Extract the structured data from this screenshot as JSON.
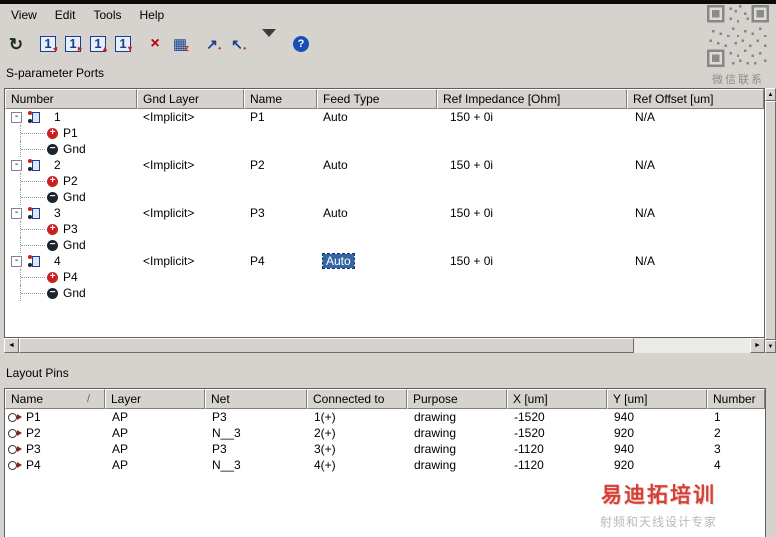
{
  "menubar": {
    "items": [
      "View",
      "Edit",
      "Tools",
      "Help"
    ]
  },
  "toolbar": {
    "buttons": [
      {
        "name": "refresh-ports",
        "main": "↻",
        "accent": ""
      },
      {
        "name": "port-properties",
        "main": "1",
        "accent": "◂"
      },
      {
        "name": "renumber-ports",
        "main": "1",
        "accent": "▸"
      },
      {
        "name": "move-port-up",
        "main": "1",
        "accent": "▴"
      },
      {
        "name": "move-port-down",
        "main": "1",
        "accent": "▾"
      },
      {
        "name": "delete-port",
        "main": "×",
        "accent": ""
      },
      {
        "name": "impedance-editor",
        "main": "▦",
        "accent": "z"
      },
      {
        "name": "align-pins",
        "main": "↗",
        "accent": "•"
      },
      {
        "name": "pick-pins",
        "main": "↖",
        "accent": "•"
      },
      {
        "name": "filter",
        "main": "",
        "accent": ""
      },
      {
        "name": "help",
        "main": "?",
        "accent": ""
      }
    ]
  },
  "sections": {
    "sparam_title": "S-parameter Ports",
    "layout_pins_title": "Layout Pins"
  },
  "sparam_table": {
    "columns": [
      "Number",
      "Gnd Layer",
      "Name",
      "Feed Type",
      "Ref Impedance [Ohm]",
      "Ref Offset [um]"
    ],
    "groups": [
      {
        "number": "1",
        "gnd_layer": "<Implicit>",
        "name": "P1",
        "feed_type": "Auto",
        "ref_impedance": "150 + 0i",
        "ref_offset": "N/A",
        "feed_selected": false,
        "pins": [
          {
            "label": "P1"
          },
          {
            "label": "Gnd"
          }
        ]
      },
      {
        "number": "2",
        "gnd_layer": "<Implicit>",
        "name": "P2",
        "feed_type": "Auto",
        "ref_impedance": "150 + 0i",
        "ref_offset": "N/A",
        "feed_selected": false,
        "pins": [
          {
            "label": "P2"
          },
          {
            "label": "Gnd"
          }
        ]
      },
      {
        "number": "3",
        "gnd_layer": "<Implicit>",
        "name": "P3",
        "feed_type": "Auto",
        "ref_impedance": "150 + 0i",
        "ref_offset": "N/A",
        "feed_selected": false,
        "pins": [
          {
            "label": "P3"
          },
          {
            "label": "Gnd"
          }
        ]
      },
      {
        "number": "4",
        "gnd_layer": "<Implicit>",
        "name": "P4",
        "feed_type": "Auto",
        "ref_impedance": "150 + 0i",
        "ref_offset": "N/A",
        "feed_selected": true,
        "pins": [
          {
            "label": "P4"
          },
          {
            "label": "Gnd"
          }
        ]
      }
    ]
  },
  "layout_pins_table": {
    "columns": [
      "Name",
      "Layer",
      "Net",
      "Connected to",
      "Purpose",
      "X [um]",
      "Y [um]",
      "Number"
    ],
    "rows": [
      {
        "name": "P1",
        "layer": "AP",
        "net": "P3",
        "connected_to": "1(+)",
        "purpose": "drawing",
        "x": "-1520",
        "y": "940",
        "number": "1"
      },
      {
        "name": "P2",
        "layer": "AP",
        "net": "N__3",
        "connected_to": "2(+)",
        "purpose": "drawing",
        "x": "-1520",
        "y": "920",
        "number": "2"
      },
      {
        "name": "P3",
        "layer": "AP",
        "net": "P3",
        "connected_to": "3(+)",
        "purpose": "drawing",
        "x": "-1120",
        "y": "940",
        "number": "3"
      },
      {
        "name": "P4",
        "layer": "AP",
        "net": "N__3",
        "connected_to": "4(+)",
        "purpose": "drawing",
        "x": "-1120",
        "y": "920",
        "number": "4"
      }
    ]
  },
  "icons": {
    "expander": "-",
    "plus_pin": "+",
    "minus_pin": "−",
    "scroll_left": "◄",
    "scroll_right": "►",
    "scroll_up": "▲",
    "scroll_down": "▼",
    "sort": "/"
  },
  "watermarks": {
    "qr_caption": "微信联系",
    "brand": "易迪拓培训",
    "tagline": "射频和天线设计专家"
  },
  "colors": {
    "selection_bg": "#3465a4",
    "window_bg": "#d6d3ce",
    "brand_red": "#d4403a"
  }
}
